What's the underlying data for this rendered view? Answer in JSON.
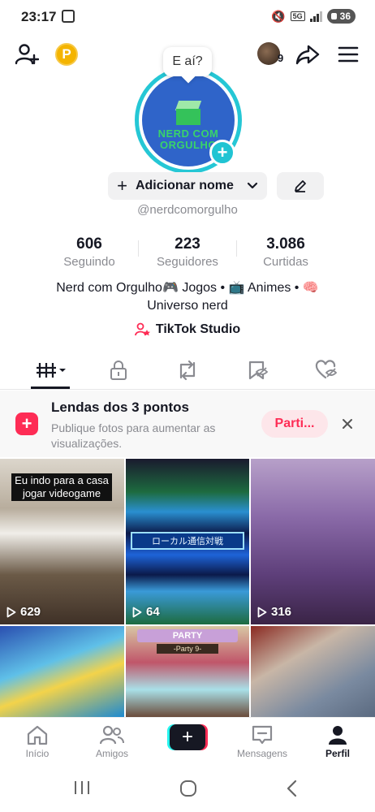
{
  "status_bar": {
    "time": "23:17",
    "network": "5G",
    "battery": "36"
  },
  "top_bar": {
    "coin_letter": "P",
    "notification_count": "9"
  },
  "profile": {
    "bubble_text": "E aí?",
    "avatar_text": "NERD COM ORGULHO",
    "add_name_label": "Adicionar nome",
    "username": "@nerdcomorgulho",
    "stats": [
      {
        "value": "606",
        "label": "Seguindo"
      },
      {
        "value": "223",
        "label": "Seguidores"
      },
      {
        "value": "3.086",
        "label": "Curtidas"
      }
    ],
    "bio": "Nerd com Orgulho🎮 Jogos • 📺 Animes • 🧠 Universo nerd",
    "studio_label": "TikTok Studio"
  },
  "promo": {
    "title": "Lendas dos 3 pontos",
    "subtitle": "Publique fotos para aumentar as visualizações.",
    "button_label": "Parti..."
  },
  "videos": [
    {
      "caption": "Eu indo para a casa jogar videogame",
      "views": "629"
    },
    {
      "caption": "",
      "views": "64",
      "banner": "ローカル通信対戦"
    },
    {
      "caption": "",
      "views": "316"
    },
    {
      "caption": "",
      "views": ""
    },
    {
      "caption": "",
      "views": "",
      "banner": "PARTY",
      "sub": "-Party 9-"
    },
    {
      "caption": "",
      "views": ""
    }
  ],
  "bottom_nav": {
    "home": "Início",
    "friends": "Amigos",
    "messages": "Mensagens",
    "profile": "Perfil"
  },
  "colors": {
    "accent": "#fe2c55",
    "cyan": "#25c7d5",
    "avatar_blue": "#2f64c9",
    "coin": "#f4b400"
  }
}
